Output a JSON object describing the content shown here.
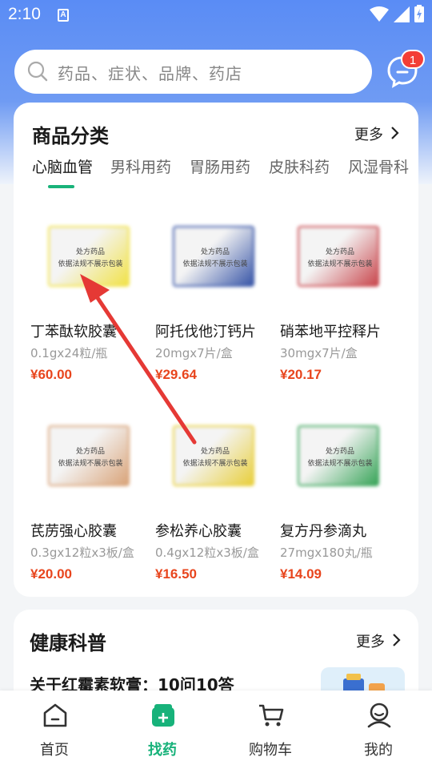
{
  "status_bar": {
    "time": "2:10",
    "a_icon_text": "A"
  },
  "search": {
    "placeholder": "药品、症状、品牌、药店",
    "badge_count": "1"
  },
  "category": {
    "title": "商品分类",
    "more": "更多",
    "tabs": [
      "心脑血管",
      "男科用药",
      "胃肠用药",
      "皮肤科药",
      "风湿骨科"
    ],
    "active_tab": 0,
    "mask_line1": "处方药品",
    "mask_line2": "依据法规不展示包装",
    "products": [
      {
        "name": "丁苯酞软胶囊",
        "spec": "0.1gx24粒/瓶",
        "price": "¥60.00",
        "color": "#f1e24a"
      },
      {
        "name": "阿托伐他汀钙片",
        "spec": "20mgx7片/盒",
        "price": "¥29.64",
        "color": "#3a57a8"
      },
      {
        "name": "硝苯地平控释片",
        "spec": "30mgx7片/盒",
        "price": "¥20.17",
        "color": "#c9484e"
      },
      {
        "name": "芪苈强心胶囊",
        "spec": "0.3gx12粒x3板/盒",
        "price": "¥20.00",
        "color": "#d9a47a"
      },
      {
        "name": "参松养心胶囊",
        "spec": "0.4gx12粒x3板/盒",
        "price": "¥16.50",
        "color": "#e8cf3d"
      },
      {
        "name": "复方丹参滴丸",
        "spec": "27mgx180丸/瓶",
        "price": "¥14.09",
        "color": "#3aa55a"
      }
    ]
  },
  "health": {
    "title": "健康科普",
    "more": "更多",
    "article_title": "关于红霉素软膏：10问10答"
  },
  "nav": [
    {
      "label": "首页",
      "icon": "home-icon"
    },
    {
      "label": "找药",
      "icon": "find-medicine-icon"
    },
    {
      "label": "购物车",
      "icon": "cart-icon"
    },
    {
      "label": "我的",
      "icon": "profile-icon"
    }
  ],
  "colors": {
    "accent": "#19b37a",
    "price": "#e8451d",
    "badge": "#f33e36",
    "header": "#5a8cf5"
  }
}
